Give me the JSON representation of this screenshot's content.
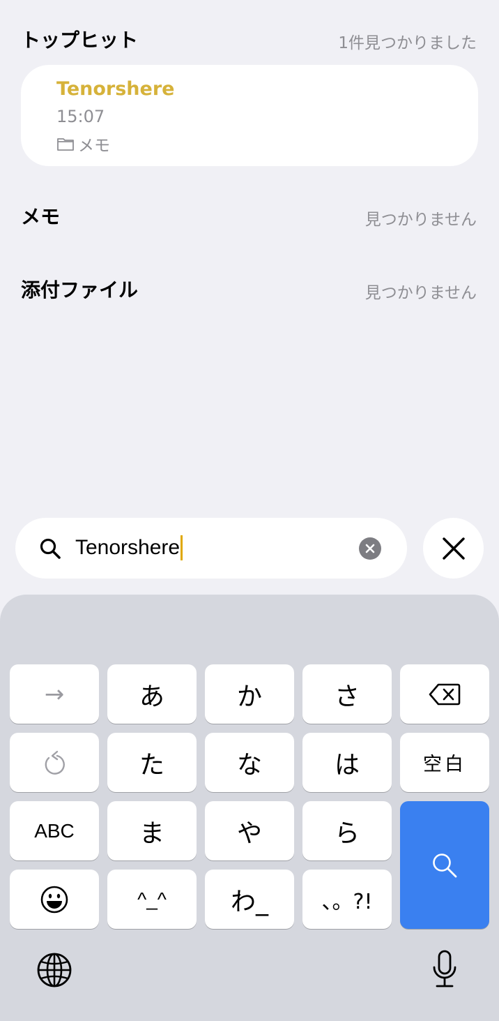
{
  "sections": {
    "top_hits": {
      "title": "トップヒット",
      "status": "1件見つかりました"
    },
    "memo": {
      "title": "メモ",
      "status": "見つかりません"
    },
    "attachments": {
      "title": "添付ファイル",
      "status": "見つかりません"
    }
  },
  "result_card": {
    "title": "Tenorshere",
    "time": "15:07",
    "folder": "メモ"
  },
  "search": {
    "value": "Tenorshere"
  },
  "keyboard": {
    "rows": [
      [
        "→",
        "あ",
        "か",
        "さ",
        "delete"
      ],
      [
        "undo",
        "た",
        "な",
        "は",
        "空白"
      ],
      [
        "ABC",
        "ま",
        "や",
        "ら",
        "search"
      ],
      [
        "emoji",
        "^_^",
        "わ_",
        "、。?!"
      ]
    ],
    "labels": {
      "arrow": "→",
      "a": "あ",
      "ka": "か",
      "sa": "さ",
      "ta": "た",
      "na": "な",
      "ha": "は",
      "space": "空白",
      "abc": "ABC",
      "ma": "ま",
      "ya": "や",
      "ra": "ら",
      "kaomoji": "^_^",
      "wa": "わ_",
      "punct": "、。?!"
    },
    "icons": {
      "delete": "delete-backspace-icon",
      "undo": "undo-icon",
      "search": "search-icon",
      "emoji": "emoji-icon",
      "globe": "globe-icon",
      "mic": "microphone-icon"
    }
  },
  "colors": {
    "accent_yellow": "#d6b23a",
    "search_key_blue": "#3a80f0",
    "background": "#f0f0f5",
    "keyboard_bg": "#d5d7de",
    "secondary_text": "#8e8e93"
  }
}
